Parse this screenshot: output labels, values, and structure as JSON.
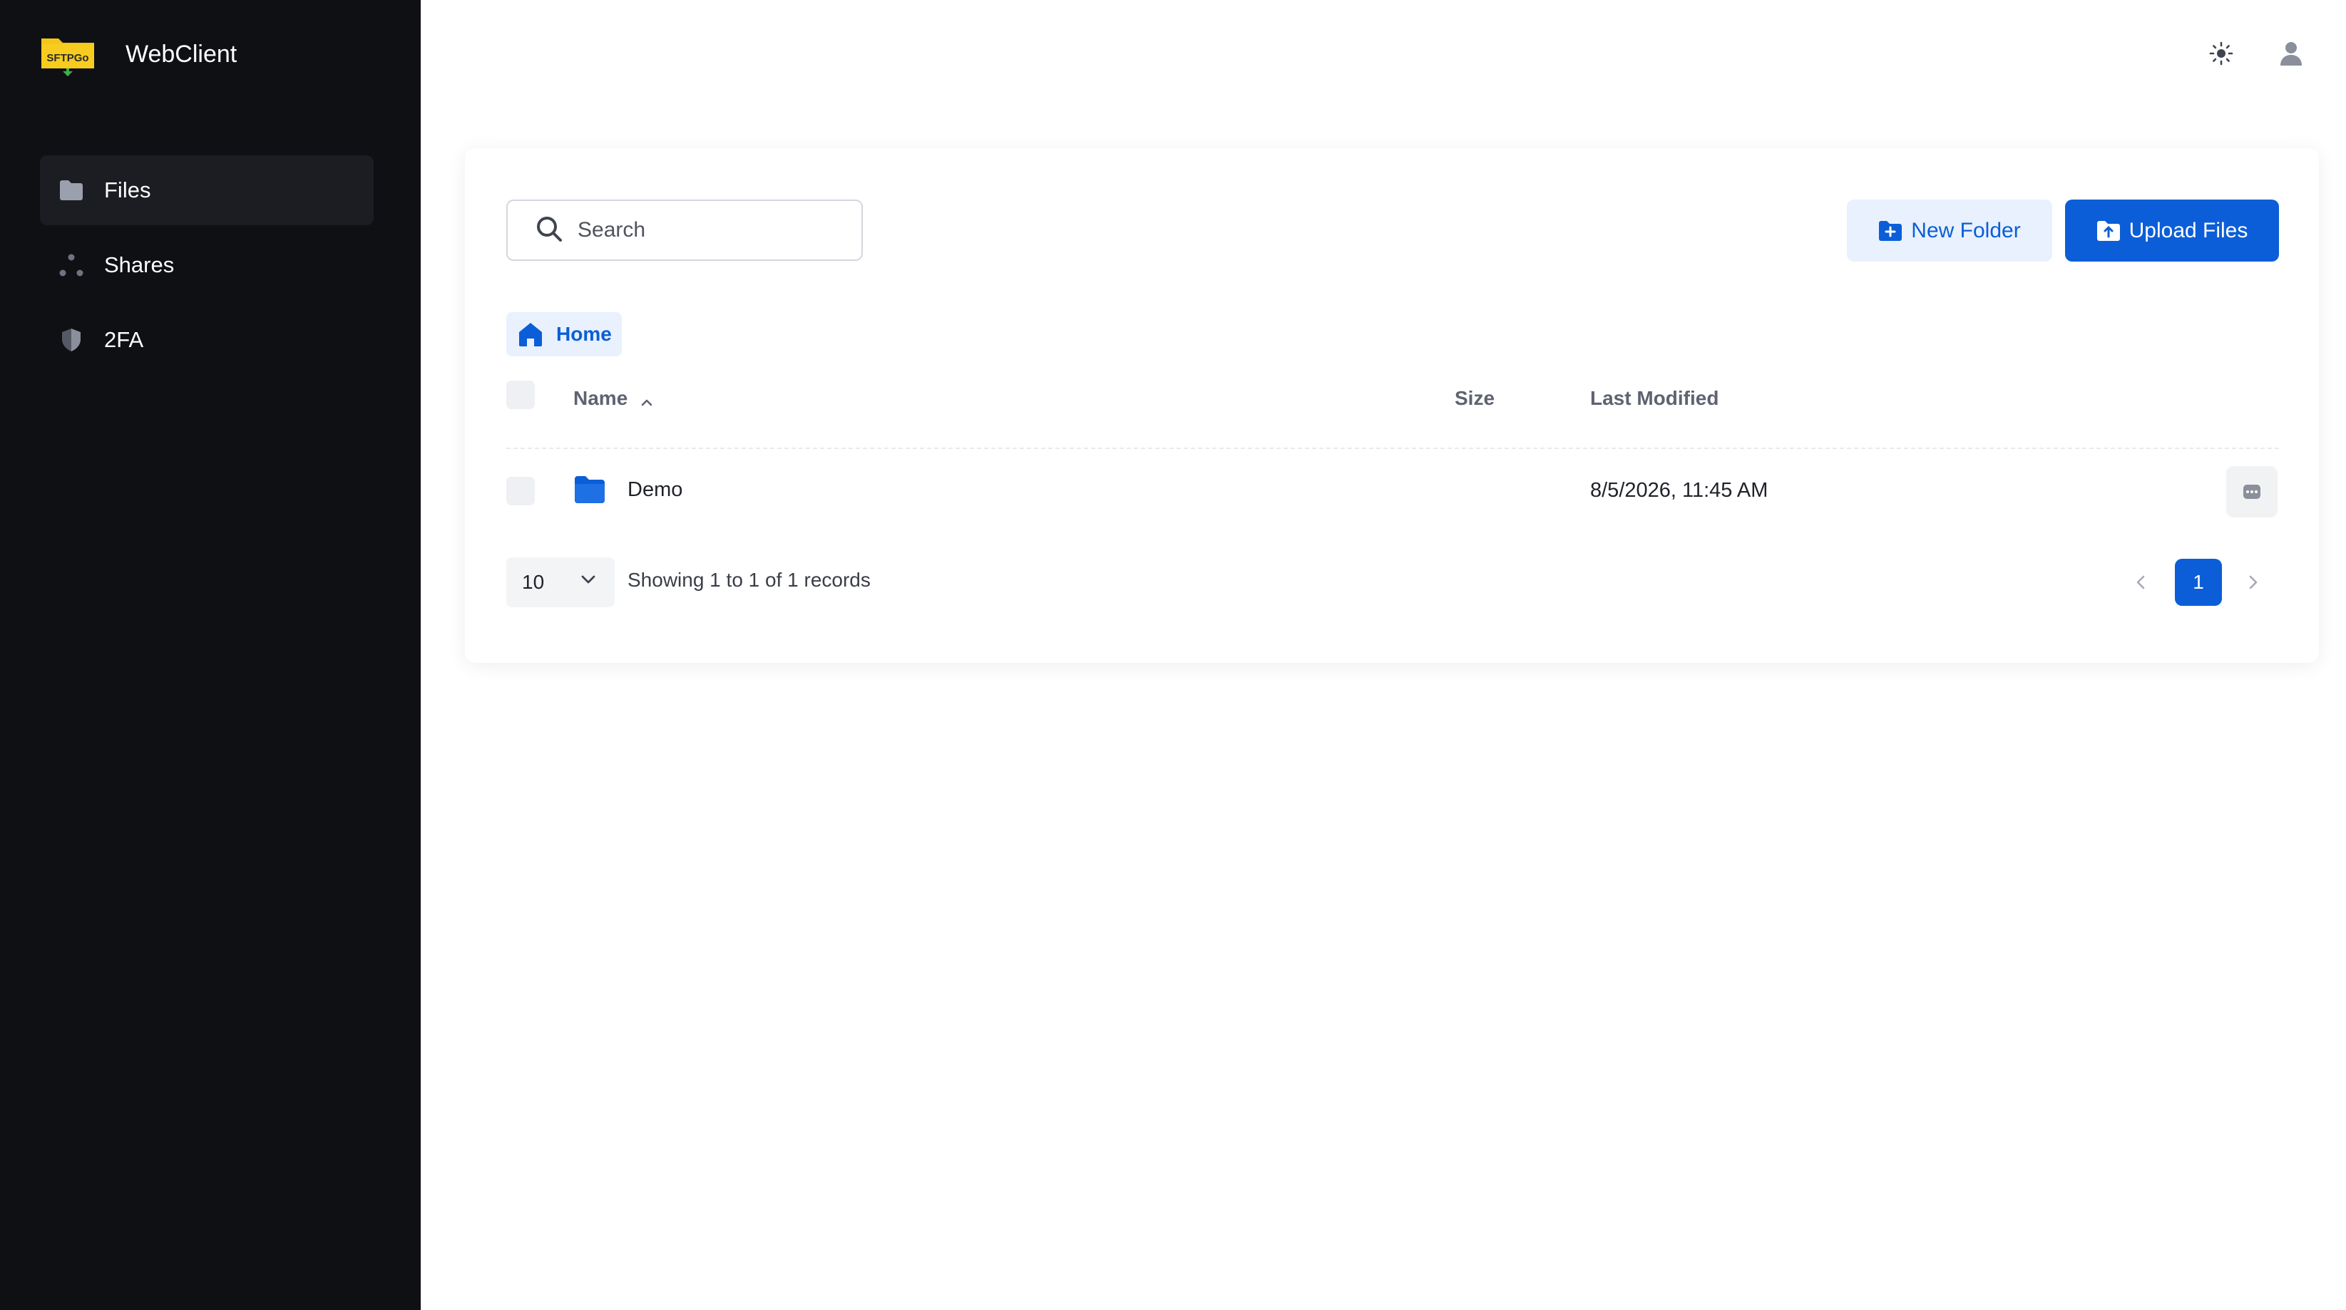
{
  "app": {
    "title": "WebClient",
    "logo_text": "SFTPGo"
  },
  "sidebar": {
    "items": [
      {
        "label": "Files",
        "icon": "folder-icon",
        "active": true
      },
      {
        "label": "Shares",
        "icon": "share-icon",
        "active": false
      },
      {
        "label": "2FA",
        "icon": "shield-icon",
        "active": false
      }
    ]
  },
  "header": {
    "theme_icon": "sun-icon",
    "user_icon": "user-icon"
  },
  "toolbar": {
    "search_placeholder": "Search",
    "new_folder_label": "New Folder",
    "upload_label": "Upload Files"
  },
  "breadcrumb": {
    "items": [
      "Home"
    ]
  },
  "table": {
    "columns": [
      "Name",
      "Size",
      "Last Modified"
    ],
    "sort": {
      "column": "Name",
      "direction": "asc"
    },
    "rows": [
      {
        "name": "Demo",
        "type": "folder",
        "size": "",
        "last_modified": "8/5/2026, 11:45 AM"
      }
    ]
  },
  "pagination": {
    "page_size": "10",
    "summary": "Showing 1 to 1 of 1 records",
    "current_page": "1"
  },
  "colors": {
    "sidebar_bg": "#0f1014",
    "primary": "#0b5ed7",
    "primary_light": "#e8f1fd",
    "logo_yellow": "#f5c518"
  }
}
